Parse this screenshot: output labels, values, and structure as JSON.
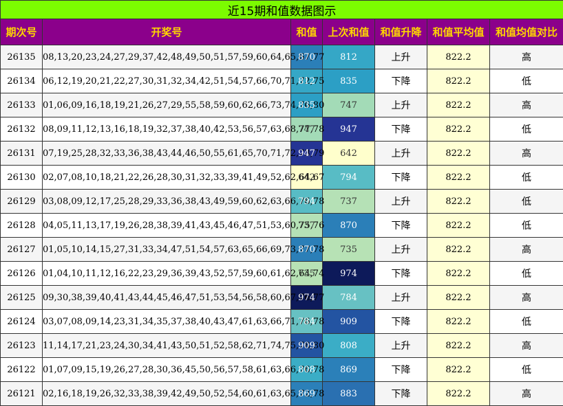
{
  "title": "近15期和值数据图示",
  "headers": [
    "期次号",
    "开奖号",
    "和值",
    "上次和值",
    "和值升降",
    "和值平均值",
    "和值均值对比"
  ],
  "rows": [
    {
      "period": "26135",
      "numbers": "08,13,20,23,24,27,29,37,42,48,49,50,51,57,59,60,64,65,67,77",
      "sum": "870",
      "sum_color": "#2b7fb8",
      "prev_sum": "812",
      "prev_color": "#35a7c6",
      "trend": "上升",
      "avg": "822.2",
      "compare": "高"
    },
    {
      "period": "26134",
      "numbers": "06,12,19,20,21,22,27,30,31,32,34,42,51,54,57,66,70,71,72,75",
      "sum": "812",
      "sum_color": "#35a7c6",
      "prev_sum": "835",
      "prev_color": "#2c9fc5",
      "trend": "下降",
      "avg": "822.2",
      "compare": "低"
    },
    {
      "period": "26133",
      "numbers": "01,06,09,16,18,19,21,26,27,29,55,58,59,60,62,66,73,74,76,80",
      "sum": "835",
      "sum_color": "#2c9fc5",
      "prev_sum": "747",
      "prev_color": "#a3dbb7",
      "trend": "上升",
      "avg": "822.2",
      "compare": "高"
    },
    {
      "period": "26132",
      "numbers": "08,09,11,12,13,16,18,19,32,37,38,40,42,53,56,57,63,68,77,78",
      "sum": "747",
      "sum_color": "#a3dbb7",
      "prev_sum": "947",
      "prev_color": "#253494",
      "trend": "下降",
      "avg": "822.2",
      "compare": "低"
    },
    {
      "period": "26131",
      "numbers": "07,19,25,28,32,33,36,38,43,44,46,50,55,61,65,70,71,72,73,79",
      "sum": "947",
      "sum_color": "#253494",
      "prev_sum": "642",
      "prev_color": "#ffffcc",
      "trend": "上升",
      "avg": "822.2",
      "compare": "高"
    },
    {
      "period": "26130",
      "numbers": "02,07,08,10,18,21,22,26,28,30,31,32,33,39,41,49,52,62,64,67",
      "sum": "642",
      "sum_color": "#ffffcc",
      "prev_sum": "794",
      "prev_color": "#58bcc5",
      "trend": "下降",
      "avg": "822.2",
      "compare": "低"
    },
    {
      "period": "26129",
      "numbers": "03,08,09,12,17,25,28,29,33,36,38,43,49,59,60,62,63,66,76,78",
      "sum": "794",
      "sum_color": "#58bcc5",
      "prev_sum": "737",
      "prev_color": "#b5e1b6",
      "trend": "上升",
      "avg": "822.2",
      "compare": "低"
    },
    {
      "period": "26128",
      "numbers": "04,05,11,13,17,19,26,28,38,39,41,43,45,46,47,51,53,60,75,76",
      "sum": "737",
      "sum_color": "#b5e1b6",
      "prev_sum": "870",
      "prev_color": "#2b7fb8",
      "trend": "下降",
      "avg": "822.2",
      "compare": "低"
    },
    {
      "period": "26127",
      "numbers": "01,05,10,14,15,27,31,33,34,47,51,54,57,63,65,66,69,73,77,78",
      "sum": "870",
      "sum_color": "#2b7fb8",
      "prev_sum": "735",
      "prev_color": "#b7e2b5",
      "trend": "上升",
      "avg": "822.2",
      "compare": "高"
    },
    {
      "period": "26126",
      "numbers": "01,04,10,11,12,16,22,23,29,36,39,43,52,57,59,60,61,62,64,74",
      "sum": "735",
      "sum_color": "#b7e2b5",
      "prev_sum": "974",
      "prev_color": "#0d1a5a",
      "trend": "下降",
      "avg": "822.2",
      "compare": "低"
    },
    {
      "period": "26125",
      "numbers": "09,30,38,39,40,41,43,44,45,46,47,51,53,54,56,58,60,67,76,77",
      "sum": "974",
      "sum_color": "#0d1a5a",
      "prev_sum": "784",
      "prev_color": "#67c1c3",
      "trend": "上升",
      "avg": "822.2",
      "compare": "高"
    },
    {
      "period": "26124",
      "numbers": "03,07,08,09,14,23,31,34,35,37,38,40,43,47,61,63,66,71,76,78",
      "sum": "784",
      "sum_color": "#67c1c3",
      "prev_sum": "909",
      "prev_color": "#2354a2",
      "trend": "下降",
      "avg": "822.2",
      "compare": "低"
    },
    {
      "period": "26123",
      "numbers": "11,14,17,21,23,24,30,34,41,43,50,51,52,58,62,71,74,75,78,80",
      "sum": "909",
      "sum_color": "#2354a2",
      "prev_sum": "808",
      "prev_color": "#3badc6",
      "trend": "上升",
      "avg": "822.2",
      "compare": "高"
    },
    {
      "period": "26122",
      "numbers": "01,07,09,15,19,26,27,28,30,36,45,50,56,57,58,61,63,66,76,78",
      "sum": "808",
      "sum_color": "#3badc6",
      "prev_sum": "869",
      "prev_color": "#2b80b9",
      "trend": "下降",
      "avg": "822.2",
      "compare": "低"
    },
    {
      "period": "26121",
      "numbers": "02,16,18,19,26,32,33,38,39,42,49,50,52,54,60,61,63,65,72,78",
      "sum": "869",
      "sum_color": "#2b80b9",
      "prev_sum": "883",
      "prev_color": "#2a70b1",
      "trend": "下降",
      "avg": "822.2",
      "compare": "高"
    }
  ]
}
